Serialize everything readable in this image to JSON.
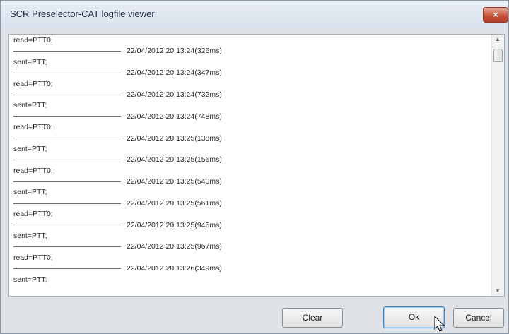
{
  "window": {
    "title": "SCR Preselector-CAT logfile viewer",
    "close_label": "×"
  },
  "log": {
    "lines": [
      {
        "text": "read=PTT0;",
        "timestamp": false
      },
      {
        "text": "22/04/2012 20:13:24(326ms)",
        "timestamp": true
      },
      {
        "text": "sent=PTT;",
        "timestamp": false
      },
      {
        "text": "22/04/2012 20:13:24(347ms)",
        "timestamp": true
      },
      {
        "text": "read=PTT0;",
        "timestamp": false
      },
      {
        "text": "22/04/2012 20:13:24(732ms)",
        "timestamp": true
      },
      {
        "text": "sent=PTT;",
        "timestamp": false
      },
      {
        "text": "22/04/2012 20:13:24(748ms)",
        "timestamp": true
      },
      {
        "text": "read=PTT0;",
        "timestamp": false
      },
      {
        "text": "22/04/2012 20:13:25(138ms)",
        "timestamp": true
      },
      {
        "text": "sent=PTT;",
        "timestamp": false
      },
      {
        "text": "22/04/2012 20:13:25(156ms)",
        "timestamp": true
      },
      {
        "text": "read=PTT0;",
        "timestamp": false
      },
      {
        "text": "22/04/2012 20:13:25(540ms)",
        "timestamp": true
      },
      {
        "text": "sent=PTT;",
        "timestamp": false
      },
      {
        "text": "22/04/2012 20:13:25(561ms)",
        "timestamp": true
      },
      {
        "text": "read=PTT0;",
        "timestamp": false
      },
      {
        "text": "22/04/2012 20:13:25(945ms)",
        "timestamp": true
      },
      {
        "text": "sent=PTT;",
        "timestamp": false
      },
      {
        "text": "22/04/2012 20:13:25(967ms)",
        "timestamp": true
      },
      {
        "text": "read=PTT0;",
        "timestamp": false
      },
      {
        "text": "22/04/2012 20:13:26(349ms)",
        "timestamp": true
      },
      {
        "text": "sent=PTT;",
        "timestamp": false
      }
    ]
  },
  "buttons": {
    "clear": "Clear",
    "ok": "Ok",
    "cancel": "Cancel"
  },
  "icons": {
    "scroll_up": "scroll-up-arrow-icon",
    "scroll_down": "scroll-down-arrow-icon",
    "cursor": "mouse-pointer-icon"
  },
  "colors": {
    "titlebar": "#dde5ef",
    "close": "#c44e37",
    "ok_border": "#3f7fbf"
  }
}
